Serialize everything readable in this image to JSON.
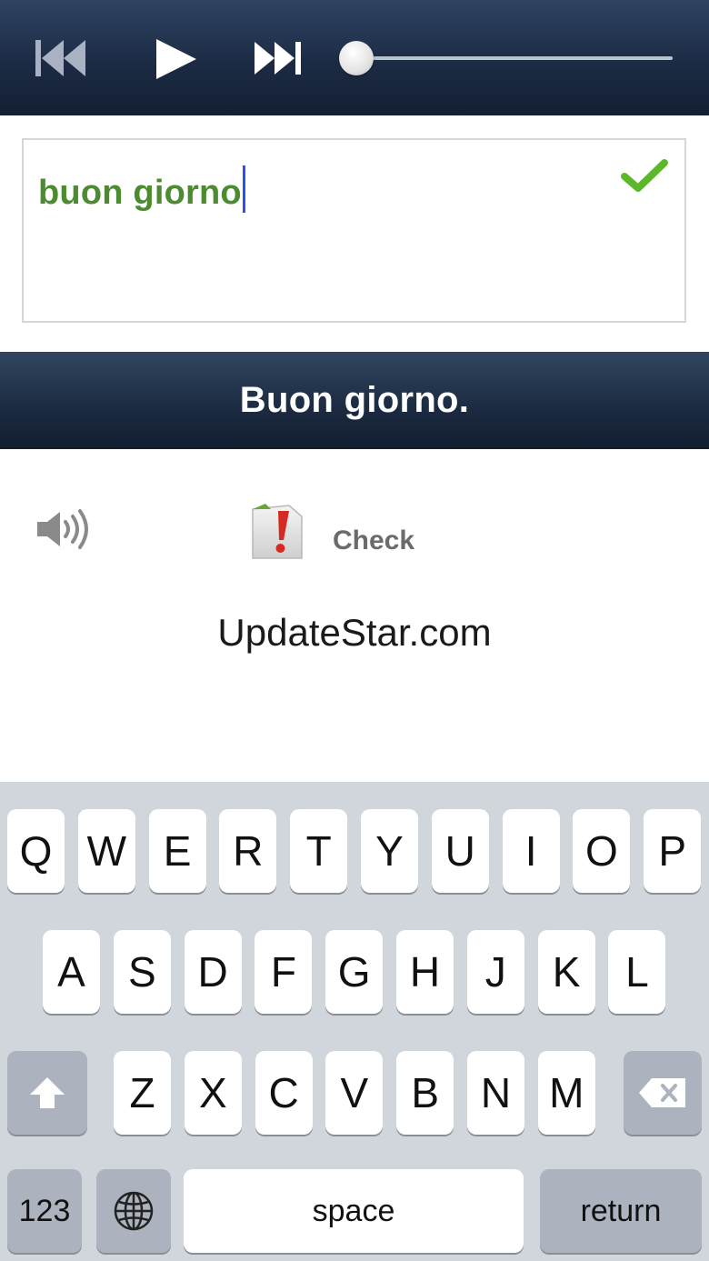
{
  "player": {
    "prev_icon": "skip-back-icon",
    "play_icon": "play-icon",
    "next_icon": "skip-forward-icon",
    "progress": 0.0
  },
  "answer": {
    "typed_text": "buon giorno",
    "status_icon": "checkmark-icon",
    "status_color": "#5cb82a"
  },
  "phrase": {
    "text": "Buon giorno."
  },
  "actions": {
    "speaker_icon": "speaker-icon",
    "check_icon": "exclamation-note-icon",
    "check_label": "Check"
  },
  "watermark": "UpdateStar.com",
  "keyboard": {
    "row1": [
      "Q",
      "W",
      "E",
      "R",
      "T",
      "Y",
      "U",
      "I",
      "O",
      "P"
    ],
    "row2": [
      "A",
      "S",
      "D",
      "F",
      "G",
      "H",
      "J",
      "K",
      "L"
    ],
    "row3": [
      "Z",
      "X",
      "C",
      "V",
      "B",
      "N",
      "M"
    ],
    "shift_icon": "shift-icon",
    "delete_icon": "backspace-icon",
    "numbers_label": "123",
    "globe_icon": "globe-icon",
    "space_label": "space",
    "return_label": "return"
  },
  "colors": {
    "bar_dark": "#1c2b44",
    "answer_green": "#4c8b2f",
    "caret_blue": "#2a52e6",
    "keyboard_bg": "#d1d5dc"
  }
}
